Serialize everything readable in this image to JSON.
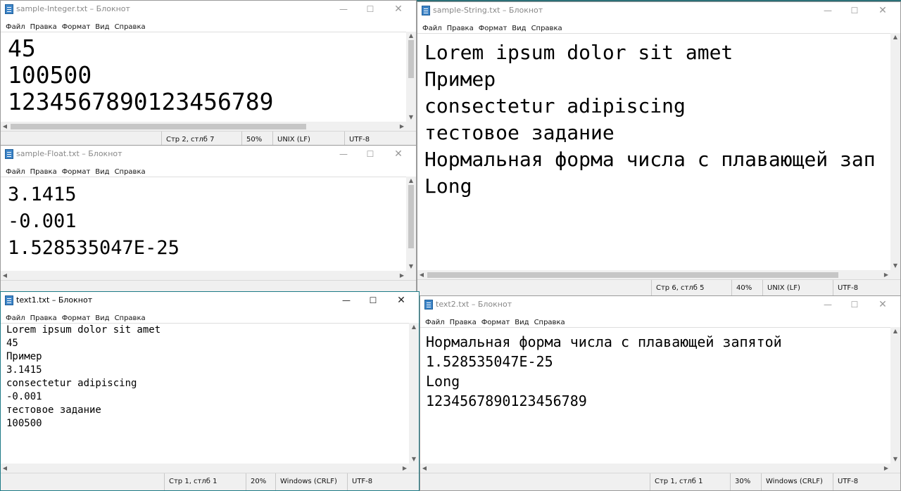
{
  "menu": [
    "Файл",
    "Правка",
    "Формат",
    "Вид",
    "Справка"
  ],
  "controls": {
    "minimize": "—",
    "maximize": "☐",
    "close": "✕"
  },
  "arrows": {
    "up": "▲",
    "down": "▼",
    "left": "◀",
    "right": "▶"
  },
  "windows": {
    "sample_integer": {
      "title": "sample-Integer.txt – Блокнот",
      "lines": [
        "45",
        "100500",
        "1234567890123456789"
      ],
      "status": {
        "pos": "Стр 2, стлб 7",
        "zoom": "50%",
        "eol": "UNIX (LF)",
        "enc": "UTF-8"
      }
    },
    "sample_float": {
      "title": "sample-Float.txt – Блокнот",
      "lines": [
        "3.1415",
        "-0.001",
        "1.528535047E-25"
      ]
    },
    "sample_string": {
      "title": "sample-String.txt – Блокнот",
      "lines": [
        "Lorem ipsum dolor sit amet",
        "Пример",
        "consectetur adipiscing",
        "тестовое задание",
        "Нормальная форма числа с плавающей зап",
        "Long"
      ],
      "status": {
        "pos": "Стр 6, стлб 5",
        "zoom": "40%",
        "eol": "UNIX (LF)",
        "enc": "UTF-8"
      }
    },
    "text1": {
      "title": "text1.txt – Блокнот",
      "lines": [
        "Lorem ipsum dolor sit amet",
        "45",
        "Пример",
        "3.1415",
        "consectetur adipiscing",
        "-0.001",
        "тестовое задание",
        "100500"
      ],
      "status": {
        "pos": "Стр 1, стлб 1",
        "zoom": "20%",
        "eol": "Windows (CRLF)",
        "enc": "UTF-8"
      }
    },
    "text2": {
      "title": "text2.txt – Блокнот",
      "lines": [
        "Нормальная форма числа с плавающей запятой",
        "1.528535047E-25",
        "Long",
        "1234567890123456789"
      ],
      "status": {
        "pos": "Стр 1, стлб 1",
        "zoom": "30%",
        "eol": "Windows (CRLF)",
        "enc": "UTF-8"
      }
    }
  }
}
